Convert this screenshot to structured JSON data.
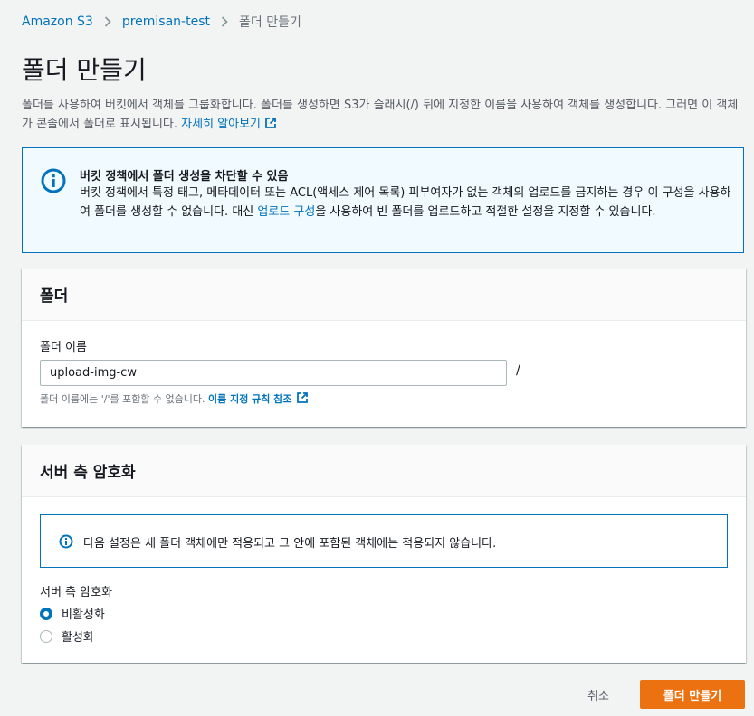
{
  "breadcrumb": {
    "items": [
      "Amazon S3",
      "premisan-test"
    ],
    "current": "폴더 만들기"
  },
  "page": {
    "title": "폴더 만들기",
    "description": "폴더를 사용하여 버킷에서 객체를 그룹화합니다. 폴더를 생성하면 S3가 슬래시(/) 뒤에 지정한 이름을 사용하여 객체를 생성합니다. 그러면 이 객체가 콘솔에서 폴더로 표시됩니다.",
    "learn_more": "자세히 알아보기"
  },
  "alert": {
    "title": "버킷 정책에서 폴더 생성을 차단할 수 있음",
    "body_before": "버킷 정책에서 특정 태그, 메타데이터 또는 ACL(액세스 제어 목록) 피부여자가 없는 객체의 업로드를 금지하는 경우 이 구성을 사용하여 폴더를 생성할 수 없습니다. 대신 ",
    "body_link": "업로드 구성",
    "body_after": "을 사용하여 빈 폴더를 업로드하고 적절한 설정을 지정할 수 있습니다."
  },
  "folder_panel": {
    "header": "폴더",
    "label": "폴더 이름",
    "value": "upload-img-cw",
    "suffix": "/",
    "hint": "폴더 이름에는 '/'를 포함할 수 없습니다.",
    "hint_link": "이름 지정 규칙 참조"
  },
  "encryption_panel": {
    "header": "서버 측 암호화",
    "info": "다음 설정은 새 폴더 객체에만 적용되고 그 안에 포함된 객체에는 적용되지 않습니다.",
    "label": "서버 측 암호화",
    "options": [
      {
        "label": "비활성화",
        "selected": true
      },
      {
        "label": "활성화",
        "selected": false
      }
    ]
  },
  "actions": {
    "cancel": "취소",
    "create": "폴더 만들기"
  },
  "colors": {
    "link": "#0073bb",
    "primary": "#ec7211",
    "info_bg": "#f1faff"
  }
}
